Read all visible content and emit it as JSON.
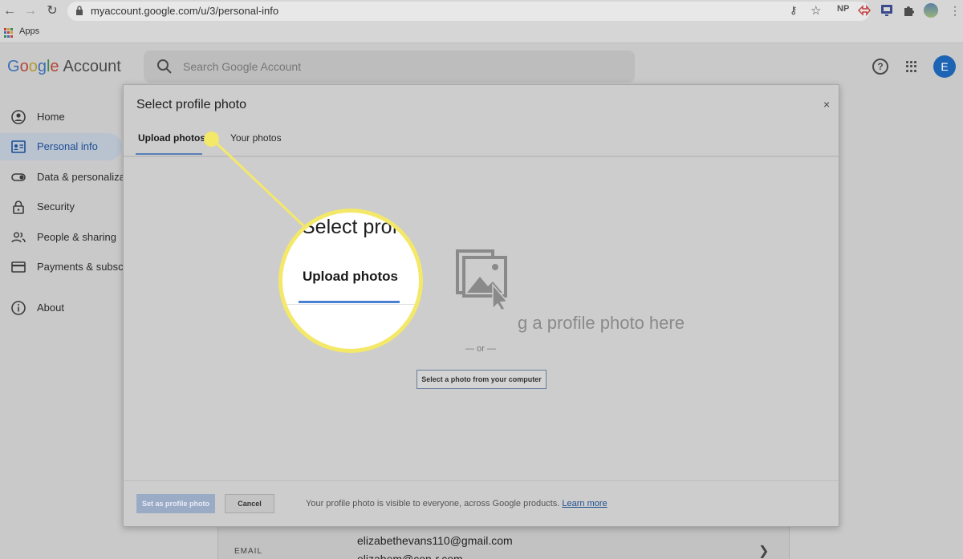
{
  "browser": {
    "url": "myaccount.google.com/u/3/personal-info",
    "extensions": [
      "NP"
    ],
    "bookmarks_apps_label": "Apps"
  },
  "header": {
    "logo_parts": [
      "G",
      "o",
      "o",
      "g",
      "l",
      "e"
    ],
    "logo_suffix": "Account",
    "search_placeholder": "Search Google Account",
    "avatar_letter": "E"
  },
  "sidebar": {
    "items": [
      {
        "label": "Home",
        "icon": "home-icon"
      },
      {
        "label": "Personal info",
        "icon": "personal-info-icon",
        "active": true
      },
      {
        "label": "Data & personaliza",
        "icon": "toggle-icon"
      },
      {
        "label": "Security",
        "icon": "lock-icon"
      },
      {
        "label": "People & sharing",
        "icon": "people-icon"
      },
      {
        "label": "Payments & subscr",
        "icon": "card-icon"
      },
      {
        "label": "About",
        "icon": "info-icon"
      }
    ]
  },
  "email_card": {
    "label": "EMAIL",
    "primary": "elizabethevans110@gmail.com",
    "secondary": "elizabem@con-r.com"
  },
  "modal": {
    "title": "Select profile photo",
    "close": "×",
    "tabs": [
      "Upload photos",
      "Your photos"
    ],
    "drag_text": "g a profile photo here",
    "or_text": "— or —",
    "select_button": "Select a photo from your computer",
    "set_button": "Set as profile photo",
    "cancel_button": "Cancel",
    "footer_note": "Your profile photo is visible to everyone, across Google products.",
    "learn_more": "Learn more"
  },
  "callout": {
    "title_fragment": "Select prof",
    "tab_label": "Upload photos",
    "color": "#f4e869"
  },
  "colors": {
    "accent": "#1a73e8",
    "overlay_dim": "#c9c9c9"
  }
}
